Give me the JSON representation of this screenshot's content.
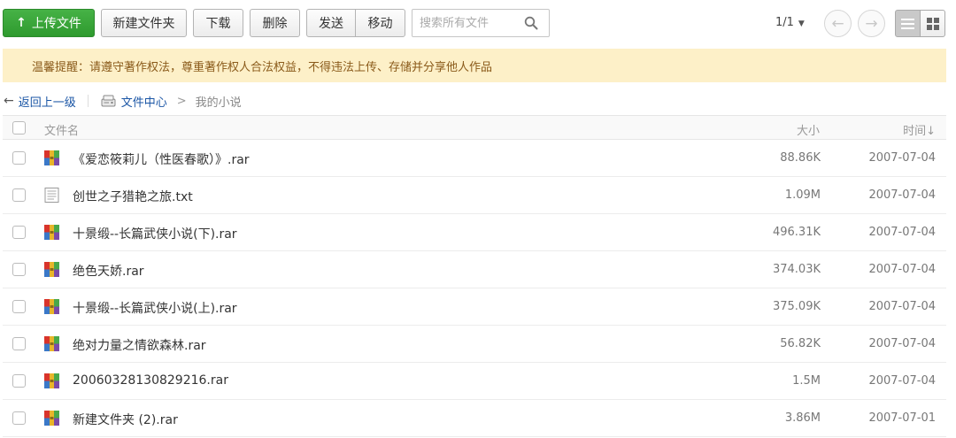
{
  "toolbar": {
    "upload_label": "上传文件",
    "new_folder_label": "新建文件夹",
    "download_label": "下载",
    "delete_label": "删除",
    "send_label": "发送",
    "move_label": "移动",
    "search_placeholder": "搜索所有文件"
  },
  "pager": {
    "page_text": "1/1"
  },
  "notice": {
    "text": "温馨提醒：请遵守著作权法，尊重著作权人合法权益，不得违法上传、存储并分享他人作品"
  },
  "breadcrumb": {
    "back_label": "返回上一级",
    "root_label": "文件中心",
    "separator": ">",
    "current_label": "我的小说"
  },
  "table": {
    "columns": {
      "name": "文件名",
      "size": "大小",
      "time": "时间↓"
    },
    "rows": [
      {
        "name": "《爱恋筱莉儿（性医春歌）》.rar",
        "size": "88.86K",
        "time": "2007-07-04",
        "icon": "rar-icon"
      },
      {
        "name": "创世之子猎艳之旅.txt",
        "size": "1.09M",
        "time": "2007-07-04",
        "icon": "txt-icon"
      },
      {
        "name": "十景缎--长篇武侠小说(下).rar",
        "size": "496.31K",
        "time": "2007-07-04",
        "icon": "rar-icon"
      },
      {
        "name": "绝色天娇.rar",
        "size": "374.03K",
        "time": "2007-07-04",
        "icon": "rar-icon"
      },
      {
        "name": "十景缎--长篇武侠小说(上).rar",
        "size": "375.09K",
        "time": "2007-07-04",
        "icon": "rar-icon"
      },
      {
        "name": "绝对力量之情欲森林.rar",
        "size": "56.82K",
        "time": "2007-07-04",
        "icon": "rar-icon"
      },
      {
        "name": "20060328130829216.rar",
        "size": "1.5M",
        "time": "2007-07-04",
        "icon": "rar-icon"
      },
      {
        "name": "新建文件夹 (2).rar",
        "size": "3.86M",
        "time": "2007-07-01",
        "icon": "rar-icon"
      }
    ]
  },
  "colors": {
    "upload_green": "#3aa63a",
    "notice_bg": "#fdf0c8",
    "notice_text": "#8a5a1a",
    "link_blue": "#1a55a5"
  }
}
